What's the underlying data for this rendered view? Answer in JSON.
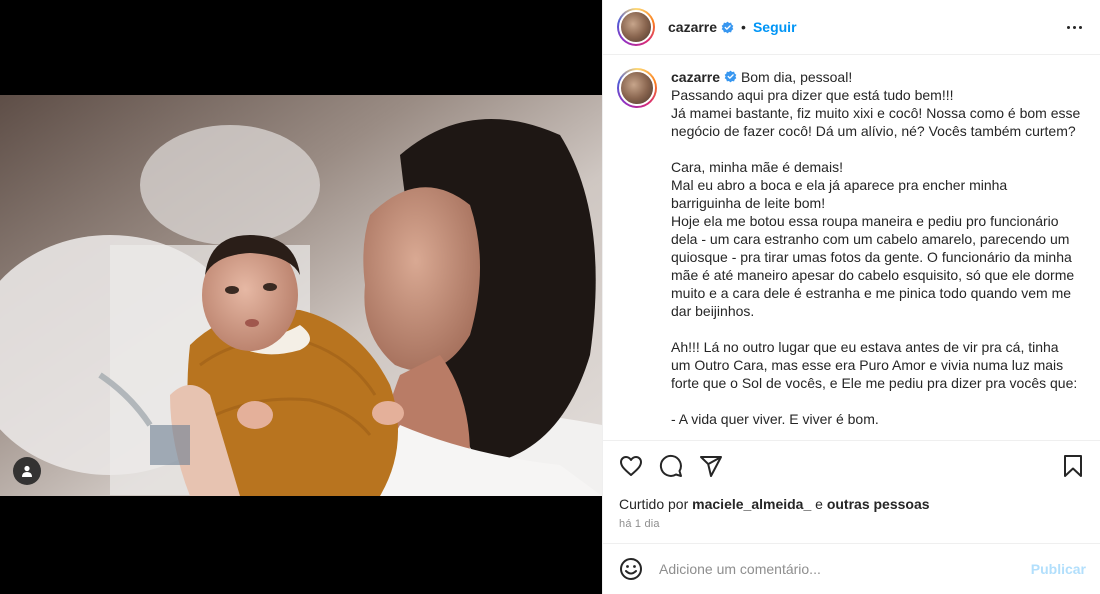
{
  "post": {
    "username": "cazarre",
    "verified": true,
    "follow_label": "Seguir",
    "separator": "•"
  },
  "caption": {
    "username": "cazarre",
    "text": "Bom dia, pessoal!\nPassando aqui pra dizer que está tudo bem!!!\nJá mamei bastante, fiz muito xixi e cocô! Nossa como é bom esse negócio de fazer cocô! Dá um alívio, né? Vocês também curtem?\n\nCara, minha mãe é demais!\nMal eu abro a boca e ela já aparece pra encher minha barriguinha de leite bom!\nHoje ela me botou essa roupa maneira e pediu pro funcionário dela - um cara estranho com um cabelo amarelo, parecendo um quiosque - pra tirar umas fotos da gente. O funcionário da minha mãe é até maneiro apesar do cabelo esquisito, só que ele dorme muito e a cara dele é estranha e me pinica todo quando vem me dar beijinhos.\n\nAh!!! Lá no outro lugar que eu estava antes de vir pra cá, tinha um Outro Cara, mas esse era Puro Amor e vivia numa luz mais forte que o Sol de vocês, e Ele me pediu pra dizer pra vocês que:\n\n- A vida quer viver. E viver é bom."
  },
  "likes": {
    "prefix": "Curtido por",
    "user": "maciele_almeida_",
    "conjunction": "e",
    "others": "outras pessoas"
  },
  "timestamp": "há 1 dia",
  "comment": {
    "placeholder": "Adicione um comentário...",
    "publish_label": "Publicar"
  },
  "colors": {
    "accent": "#0095f6",
    "publish_disabled": "#b2dffc",
    "verified": "#3897f0"
  },
  "icons": {
    "like": "heart-icon",
    "comment": "comment-icon",
    "share": "paper-plane-icon",
    "save": "bookmark-icon",
    "emoji": "emoji-icon",
    "options": "more-options-icon",
    "tag": "user-tag-icon"
  }
}
